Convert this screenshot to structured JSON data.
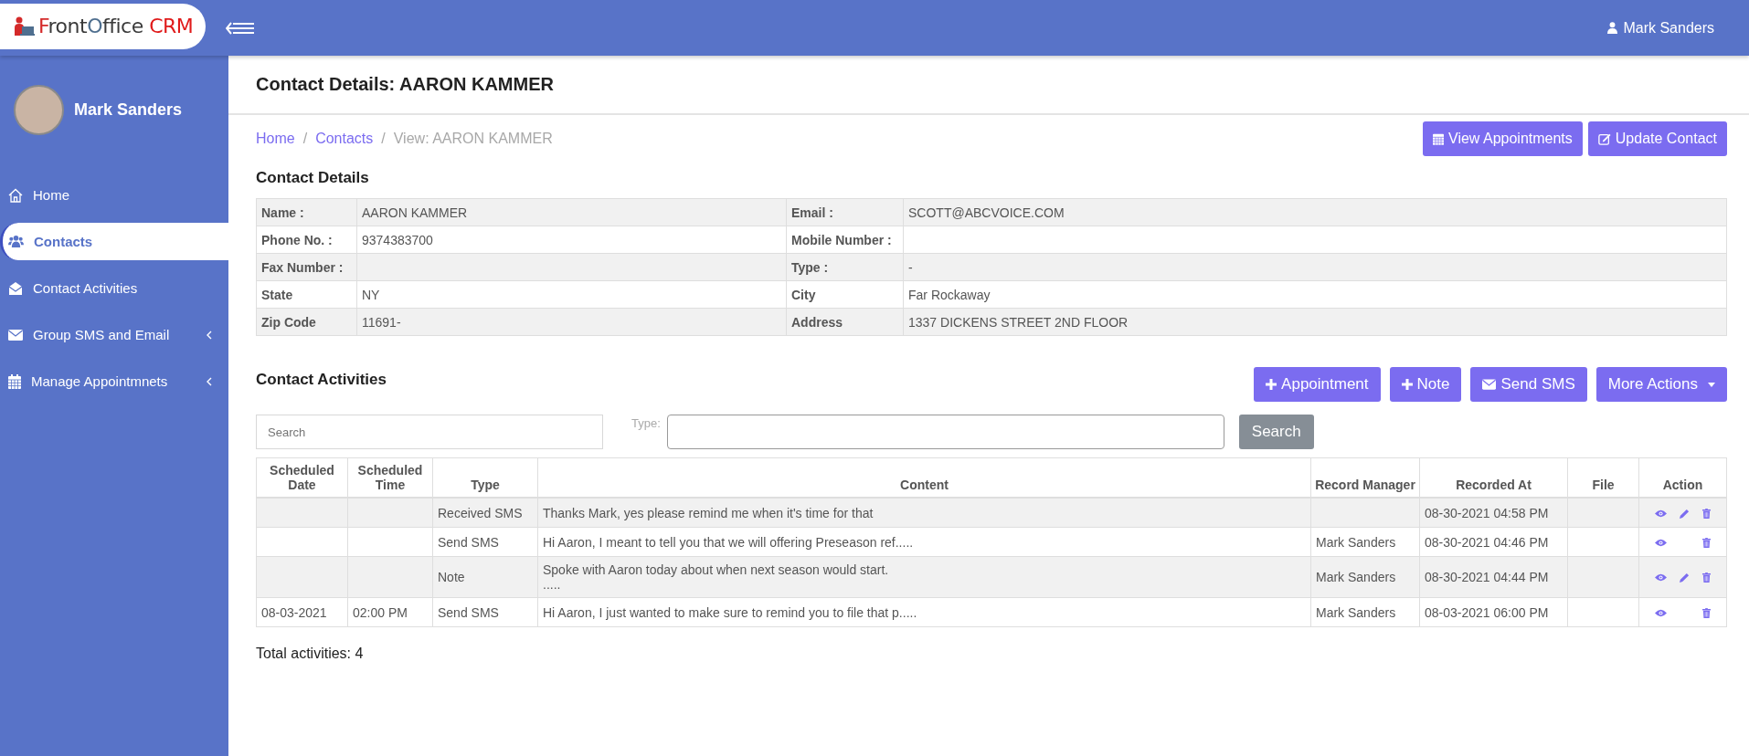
{
  "logo": {
    "parts": [
      {
        "text": "F",
        "color": "#d42a2a"
      },
      {
        "text": "ront",
        "color": "#3a3a3a"
      },
      {
        "text": "O",
        "color": "#4f6f8f"
      },
      {
        "text": "ffice",
        "color": "#3a3a3a"
      },
      {
        "text": " CRM",
        "color": "#e01b1b"
      }
    ]
  },
  "header": {
    "user": "Mark Sanders"
  },
  "sidebar": {
    "user": "Mark Sanders",
    "items": [
      {
        "label": "Home",
        "kind": "home",
        "selected": false,
        "expandable": false
      },
      {
        "label": "Contacts",
        "kind": "users",
        "selected": true,
        "expandable": false
      },
      {
        "label": "Contact Activities",
        "kind": "envelope-open",
        "selected": false,
        "expandable": false
      },
      {
        "label": "Group SMS and Email",
        "kind": "envelope",
        "selected": false,
        "expandable": true
      },
      {
        "label": "Manage Appointmnets",
        "kind": "calendar",
        "selected": false,
        "expandable": true
      }
    ]
  },
  "page": {
    "title": "Contact Details: AARON KAMMER",
    "breadcrumb_separator": "/",
    "breadcrumb": [
      {
        "label": "Home",
        "link": true
      },
      {
        "label": "Contacts",
        "link": true
      },
      {
        "label": "View: AARON KAMMER",
        "link": false
      }
    ],
    "top_buttons": [
      {
        "label": "View Appointments",
        "kind": "calendar"
      },
      {
        "label": "Update Contact",
        "kind": "edit"
      }
    ]
  },
  "details": {
    "title": "Contact Details",
    "rows": [
      [
        "Name :",
        "AARON KAMMER",
        "Email :",
        "SCOTT@ABCVOICE.COM"
      ],
      [
        "Phone No. :",
        "9374383700",
        "Mobile Number :",
        ""
      ],
      [
        "Fax Number :",
        "",
        "Type :",
        "-"
      ],
      [
        "State",
        "NY",
        "City",
        "Far Rockaway"
      ],
      [
        "Zip Code",
        "11691-",
        "Address",
        "1337 DICKENS STREET 2ND FLOOR"
      ]
    ]
  },
  "activities": {
    "title": "Contact Activities",
    "buttons": [
      {
        "label": "Appointment",
        "kind": "plus"
      },
      {
        "label": "Note",
        "kind": "plus"
      },
      {
        "label": "Send SMS",
        "kind": "envelope"
      },
      {
        "label": "More Actions",
        "kind": "dropdown"
      }
    ],
    "search": {
      "placeholder": "Search"
    },
    "type_label": "Type:",
    "search_button": "Search",
    "columns": [
      "Scheduled Date",
      "Scheduled Time",
      "Type",
      "Content",
      "Record Manager",
      "Recorded At",
      "File",
      "Action"
    ],
    "rows": [
      {
        "date": "",
        "time": "",
        "type": "Received SMS",
        "content": [
          "Thanks Mark, yes please remind me when it's time for that"
        ],
        "manager": "",
        "recorded": "08-30-2021 04:58 PM",
        "file": "",
        "actions": [
          {
            "kind": "view"
          },
          {
            "kind": "edit"
          },
          {
            "kind": "delete"
          }
        ]
      },
      {
        "date": "",
        "time": "",
        "type": "Send SMS",
        "content": [
          "Hi Aaron, I meant to tell you that we will offering Preseason ref....."
        ],
        "manager": "Mark Sanders",
        "recorded": "08-30-2021 04:46 PM",
        "file": "",
        "actions": [
          {
            "kind": "view"
          },
          {
            "kind": "delete"
          }
        ]
      },
      {
        "date": "",
        "time": "",
        "type": "Note",
        "content": [
          "Spoke with Aaron today about when next season would start.",
          "....."
        ],
        "manager": "Mark Sanders",
        "recorded": "08-30-2021 04:44 PM",
        "file": "",
        "actions": [
          {
            "kind": "view"
          },
          {
            "kind": "edit"
          },
          {
            "kind": "delete"
          }
        ]
      },
      {
        "date": "08-03-2021",
        "time": "02:00 PM",
        "type": "Send SMS",
        "content": [
          "Hi Aaron, I just wanted to make sure to remind you to file that p....."
        ],
        "manager": "Mark Sanders",
        "recorded": "08-03-2021 06:00 PM",
        "file": "",
        "actions": [
          {
            "kind": "view"
          },
          {
            "kind": "delete"
          }
        ]
      }
    ],
    "total": "Total activities: 4"
  }
}
